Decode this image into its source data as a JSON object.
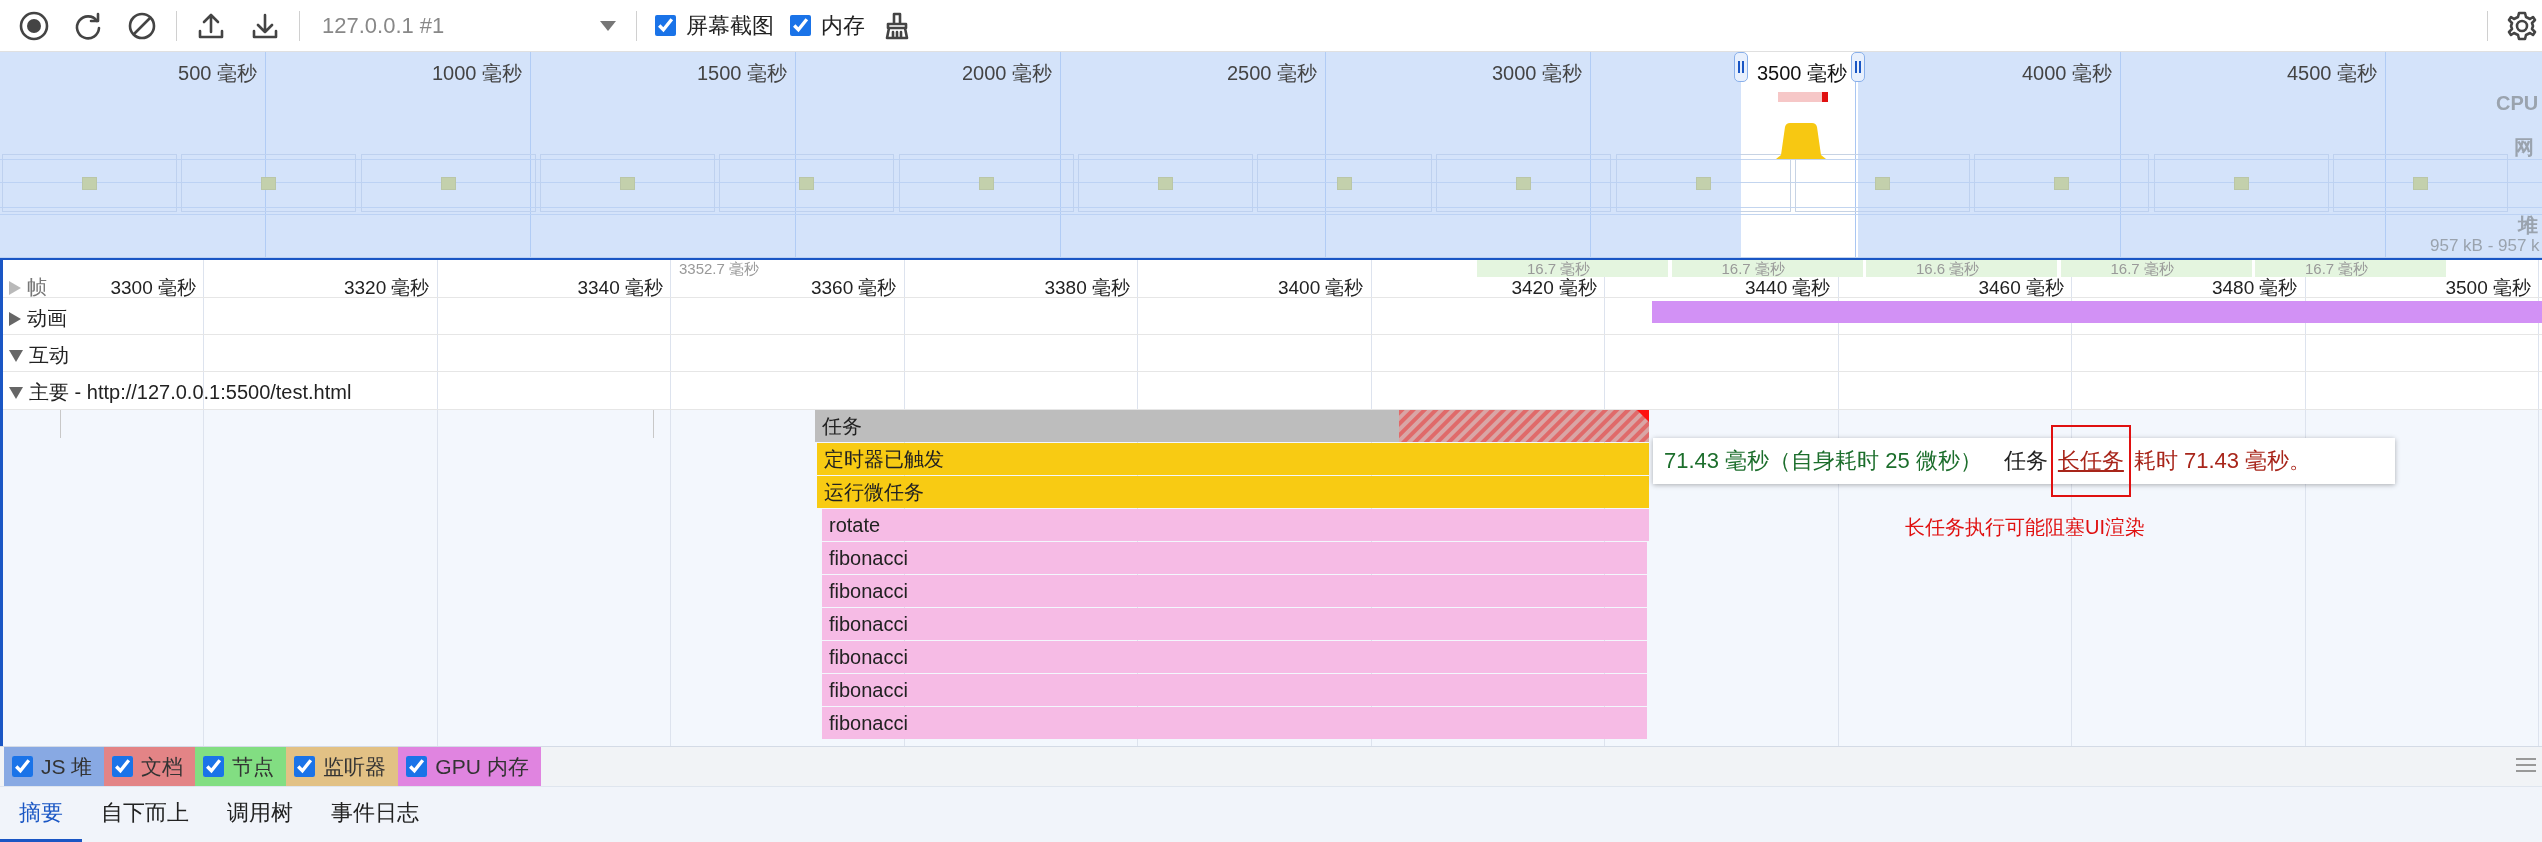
{
  "toolbar": {
    "target": "127.0.0.1 #1",
    "options": [
      {
        "label": "屏幕截图",
        "checked": true
      },
      {
        "label": "内存",
        "checked": true
      }
    ]
  },
  "overview": {
    "ticks": [
      "500 毫秒",
      "1000 毫秒",
      "1500 毫秒",
      "2000 毫秒",
      "2500 毫秒",
      "3000 毫秒",
      "3500 毫秒",
      "4000 毫秒",
      "4500 毫秒"
    ],
    "track_labels": [
      "CPU",
      "网",
      "堆"
    ],
    "heap_range": "957 kB - 957 k"
  },
  "timeline": {
    "ticks": [
      "3300 毫秒",
      "3320 毫秒",
      "3340 毫秒",
      "3360 毫秒",
      "3380 毫秒",
      "3400 毫秒",
      "3420 毫秒",
      "3440 毫秒",
      "3460 毫秒",
      "3480 毫秒",
      "3500 毫秒"
    ],
    "frames": [
      {
        "label": "3352.7 毫秒",
        "kind": "idle"
      },
      {
        "label": "16.7 毫秒",
        "kind": "frame"
      },
      {
        "label": "16.7 毫秒",
        "kind": "frame"
      },
      {
        "label": "16.6 毫秒",
        "kind": "frame"
      },
      {
        "label": "16.7 毫秒",
        "kind": "frame"
      },
      {
        "label": "16.7 毫秒",
        "kind": "frame"
      }
    ],
    "tracks": [
      {
        "label": "帧",
        "expanded": false
      },
      {
        "label": "动画",
        "expanded": false
      },
      {
        "label": "互动",
        "expanded": true
      },
      {
        "label": "主要 - http://127.0.0.1:5500/test.html",
        "expanded": true
      }
    ],
    "flame": [
      {
        "name": "任务",
        "kind": "task",
        "long_task": true
      },
      {
        "name": "定时器已触发",
        "kind": "timer",
        "long_task": false
      },
      {
        "name": "运行微任务",
        "kind": "microtask",
        "long_task": false
      },
      {
        "name": "rotate",
        "kind": "function",
        "long_task": false
      },
      {
        "name": "fibonacci",
        "kind": "function",
        "long_task": false
      },
      {
        "name": "fibonacci",
        "kind": "function",
        "long_task": false
      },
      {
        "name": "fibonacci",
        "kind": "function",
        "long_task": false
      },
      {
        "name": "fibonacci",
        "kind": "function",
        "long_task": false
      },
      {
        "name": "fibonacci",
        "kind": "function",
        "long_task": false
      },
      {
        "name": "fibonacci",
        "kind": "function",
        "long_task": false
      }
    ],
    "tooltip": {
      "duration": "71.43 毫秒（自身耗时 25 微秒）",
      "category": "任务",
      "link": "长任务",
      "warning": "耗时 71.43 毫秒。"
    },
    "annotation": "长任务执行可能阻塞UI渲染"
  },
  "memory_counters": [
    {
      "label": "JS 堆",
      "checked": true,
      "color": "#88a9e3"
    },
    {
      "label": "文档",
      "checked": true,
      "color": "#e38486"
    },
    {
      "label": "节点",
      "checked": true,
      "color": "#82de82"
    },
    {
      "label": "监听器",
      "checked": true,
      "color": "#e2c185"
    },
    {
      "label": "GPU 内存",
      "checked": true,
      "color": "#e084e0"
    }
  ],
  "bottom_tabs": [
    {
      "label": "摘要",
      "selected": true
    },
    {
      "label": "自下而上",
      "selected": false
    },
    {
      "label": "调用树",
      "selected": false
    },
    {
      "label": "事件日志",
      "selected": false
    }
  ]
}
